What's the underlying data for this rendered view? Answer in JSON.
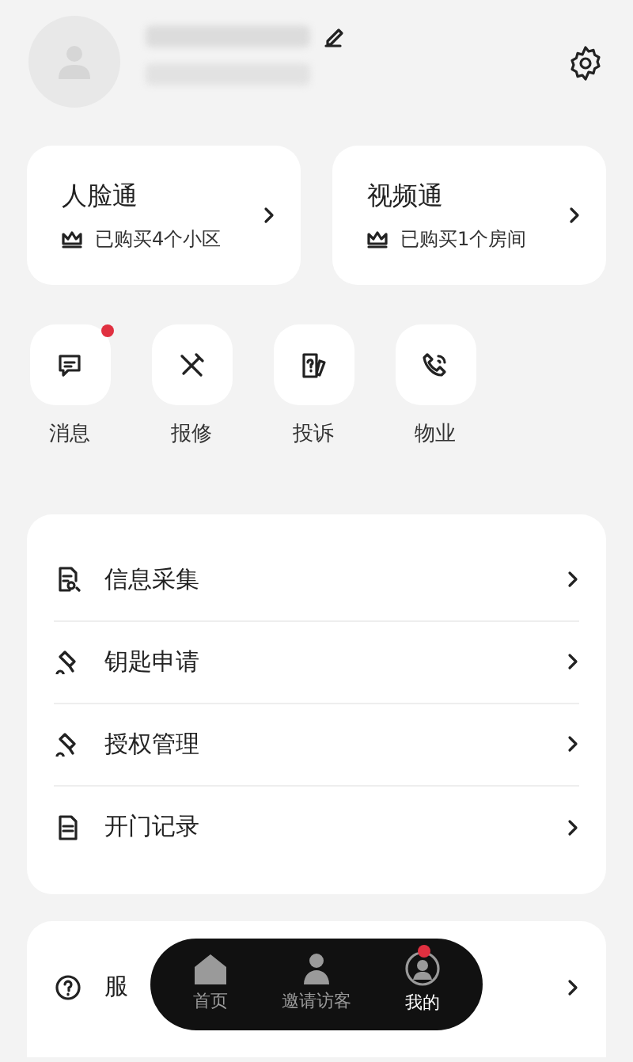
{
  "cards": [
    {
      "title": "人脸通",
      "subtitle": "已购买4个小区"
    },
    {
      "title": "视频通",
      "subtitle": "已购买1个房间"
    }
  ],
  "shortcuts": [
    {
      "label": "消息",
      "kind": "message",
      "badge": true
    },
    {
      "label": "报修",
      "kind": "repair",
      "badge": false
    },
    {
      "label": "投诉",
      "kind": "complaint",
      "badge": false
    },
    {
      "label": "物业",
      "kind": "phone",
      "badge": false
    }
  ],
  "menu": [
    {
      "label": "信息采集",
      "kind": "doc-search"
    },
    {
      "label": "钥匙申请",
      "kind": "key"
    },
    {
      "label": "授权管理",
      "kind": "key"
    },
    {
      "label": "开门记录",
      "kind": "doc"
    }
  ],
  "menu2": [
    {
      "label": "服",
      "kind": "help"
    }
  ],
  "bottom_nav": [
    {
      "label": "首页",
      "kind": "home",
      "selected": false,
      "badge": false
    },
    {
      "label": "邀请访客",
      "kind": "visitor",
      "selected": false,
      "badge": false
    },
    {
      "label": "我的",
      "kind": "me",
      "selected": true,
      "badge": true
    }
  ]
}
